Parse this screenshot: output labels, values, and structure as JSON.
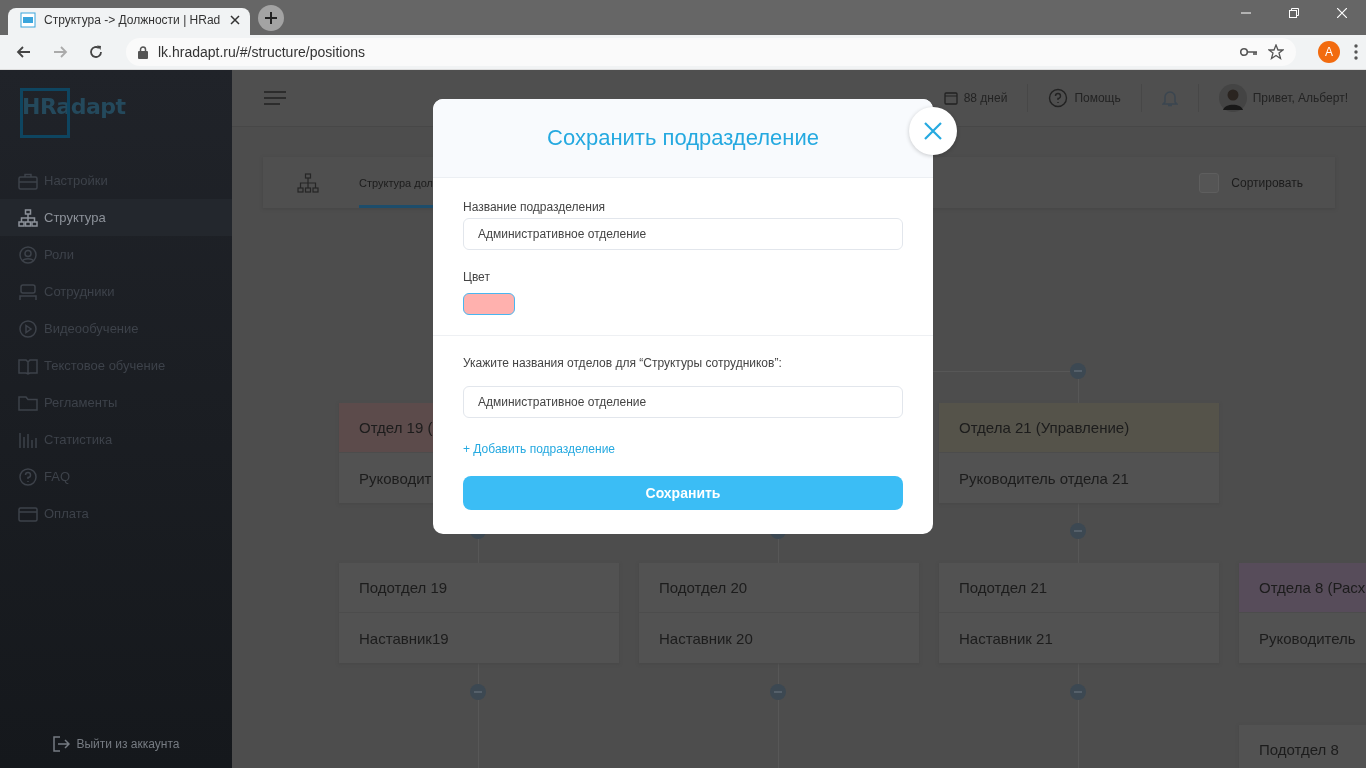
{
  "browser": {
    "tab": {
      "title": "Структура -> Должности | HRad",
      "selected": true
    },
    "url": "lk.hradapt.ru/#/structure/positions",
    "profile_initial": "A"
  },
  "sidebar": {
    "logo": "HRadapt",
    "items": [
      {
        "label": "Настройки",
        "selected": false
      },
      {
        "label": "Структура",
        "selected": true
      },
      {
        "label": "Роли",
        "selected": false
      },
      {
        "label": "Сотрудники",
        "selected": false
      },
      {
        "label": "Видеообучение",
        "selected": false
      },
      {
        "label": "Текстовое обучение",
        "selected": false
      },
      {
        "label": "Регламенты",
        "selected": false
      },
      {
        "label": "Статистика",
        "selected": false
      },
      {
        "label": "FAQ",
        "selected": false
      },
      {
        "label": "Оплата",
        "selected": false
      }
    ],
    "logout": "Выйти из аккаунта"
  },
  "header": {
    "trial": "88 дней",
    "help": "Помощь",
    "greeting": "Привет, Альберт!"
  },
  "toolbar": {
    "tabs": [
      {
        "label": "Структура дол",
        "selected": true
      }
    ],
    "sort": {
      "label": "Сортировать",
      "checked": false
    }
  },
  "org_chart": {
    "rows": [
      {
        "nodes": [
          {
            "title": "Отдел 19 (",
            "position": "Руководит",
            "color": "#5c4b4b"
          },
          {
            "title": "Отдела 21 (Управление)",
            "position": "Руководитель отдела 21",
            "color": "#55534a"
          }
        ]
      },
      {
        "nodes": [
          {
            "title": "Подотдел 19",
            "position": "Наставник19",
            "color": "#525252"
          },
          {
            "title": "Подотдел 20",
            "position": "Наставник 20",
            "color": "#525252"
          },
          {
            "title": "Подотдел 21",
            "position": "Наставник 21",
            "color": "#525252"
          },
          {
            "title": "Отдела 8 (Расх",
            "position": "Руководитель",
            "color": "#574c5a"
          }
        ]
      },
      {
        "nodes": [
          {
            "title": "Подотдел 8",
            "color": "#525252"
          }
        ]
      }
    ]
  },
  "modal": {
    "title": "Сохранить подразделение",
    "name_label": "Название подразделения",
    "name_value": "Административное отделение",
    "color_label": "Цвет",
    "color": "#ffb1ae",
    "departments_label": "Укажите названия отделов для “Структуры сотрудников”:",
    "department_value": "Административное отделение",
    "add_link": "+ Добавить подразделение",
    "save": "Сохранить"
  }
}
